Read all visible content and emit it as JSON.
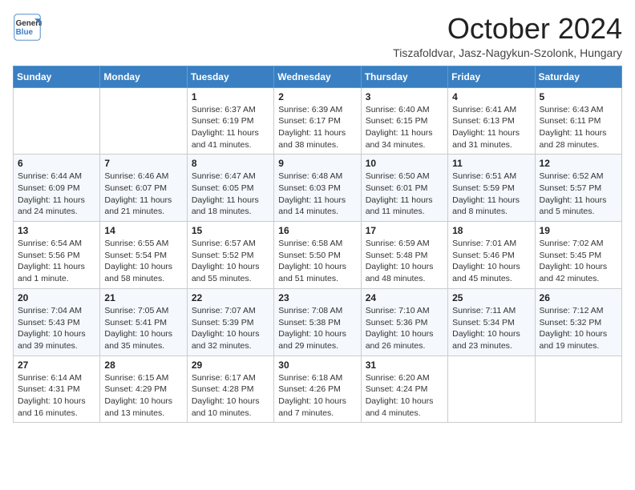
{
  "logo": {
    "line1": "General",
    "line2": "Blue"
  },
  "title": "October 2024",
  "subtitle": "Tiszafoldvar, Jasz-Nagykun-Szolonk, Hungary",
  "days_of_week": [
    "Sunday",
    "Monday",
    "Tuesday",
    "Wednesday",
    "Thursday",
    "Friday",
    "Saturday"
  ],
  "weeks": [
    [
      {
        "day": "",
        "info": ""
      },
      {
        "day": "",
        "info": ""
      },
      {
        "day": "1",
        "info": "Sunrise: 6:37 AM\nSunset: 6:19 PM\nDaylight: 11 hours and 41 minutes."
      },
      {
        "day": "2",
        "info": "Sunrise: 6:39 AM\nSunset: 6:17 PM\nDaylight: 11 hours and 38 minutes."
      },
      {
        "day": "3",
        "info": "Sunrise: 6:40 AM\nSunset: 6:15 PM\nDaylight: 11 hours and 34 minutes."
      },
      {
        "day": "4",
        "info": "Sunrise: 6:41 AM\nSunset: 6:13 PM\nDaylight: 11 hours and 31 minutes."
      },
      {
        "day": "5",
        "info": "Sunrise: 6:43 AM\nSunset: 6:11 PM\nDaylight: 11 hours and 28 minutes."
      }
    ],
    [
      {
        "day": "6",
        "info": "Sunrise: 6:44 AM\nSunset: 6:09 PM\nDaylight: 11 hours and 24 minutes."
      },
      {
        "day": "7",
        "info": "Sunrise: 6:46 AM\nSunset: 6:07 PM\nDaylight: 11 hours and 21 minutes."
      },
      {
        "day": "8",
        "info": "Sunrise: 6:47 AM\nSunset: 6:05 PM\nDaylight: 11 hours and 18 minutes."
      },
      {
        "day": "9",
        "info": "Sunrise: 6:48 AM\nSunset: 6:03 PM\nDaylight: 11 hours and 14 minutes."
      },
      {
        "day": "10",
        "info": "Sunrise: 6:50 AM\nSunset: 6:01 PM\nDaylight: 11 hours and 11 minutes."
      },
      {
        "day": "11",
        "info": "Sunrise: 6:51 AM\nSunset: 5:59 PM\nDaylight: 11 hours and 8 minutes."
      },
      {
        "day": "12",
        "info": "Sunrise: 6:52 AM\nSunset: 5:57 PM\nDaylight: 11 hours and 5 minutes."
      }
    ],
    [
      {
        "day": "13",
        "info": "Sunrise: 6:54 AM\nSunset: 5:56 PM\nDaylight: 11 hours and 1 minute."
      },
      {
        "day": "14",
        "info": "Sunrise: 6:55 AM\nSunset: 5:54 PM\nDaylight: 10 hours and 58 minutes."
      },
      {
        "day": "15",
        "info": "Sunrise: 6:57 AM\nSunset: 5:52 PM\nDaylight: 10 hours and 55 minutes."
      },
      {
        "day": "16",
        "info": "Sunrise: 6:58 AM\nSunset: 5:50 PM\nDaylight: 10 hours and 51 minutes."
      },
      {
        "day": "17",
        "info": "Sunrise: 6:59 AM\nSunset: 5:48 PM\nDaylight: 10 hours and 48 minutes."
      },
      {
        "day": "18",
        "info": "Sunrise: 7:01 AM\nSunset: 5:46 PM\nDaylight: 10 hours and 45 minutes."
      },
      {
        "day": "19",
        "info": "Sunrise: 7:02 AM\nSunset: 5:45 PM\nDaylight: 10 hours and 42 minutes."
      }
    ],
    [
      {
        "day": "20",
        "info": "Sunrise: 7:04 AM\nSunset: 5:43 PM\nDaylight: 10 hours and 39 minutes."
      },
      {
        "day": "21",
        "info": "Sunrise: 7:05 AM\nSunset: 5:41 PM\nDaylight: 10 hours and 35 minutes."
      },
      {
        "day": "22",
        "info": "Sunrise: 7:07 AM\nSunset: 5:39 PM\nDaylight: 10 hours and 32 minutes."
      },
      {
        "day": "23",
        "info": "Sunrise: 7:08 AM\nSunset: 5:38 PM\nDaylight: 10 hours and 29 minutes."
      },
      {
        "day": "24",
        "info": "Sunrise: 7:10 AM\nSunset: 5:36 PM\nDaylight: 10 hours and 26 minutes."
      },
      {
        "day": "25",
        "info": "Sunrise: 7:11 AM\nSunset: 5:34 PM\nDaylight: 10 hours and 23 minutes."
      },
      {
        "day": "26",
        "info": "Sunrise: 7:12 AM\nSunset: 5:32 PM\nDaylight: 10 hours and 19 minutes."
      }
    ],
    [
      {
        "day": "27",
        "info": "Sunrise: 6:14 AM\nSunset: 4:31 PM\nDaylight: 10 hours and 16 minutes."
      },
      {
        "day": "28",
        "info": "Sunrise: 6:15 AM\nSunset: 4:29 PM\nDaylight: 10 hours and 13 minutes."
      },
      {
        "day": "29",
        "info": "Sunrise: 6:17 AM\nSunset: 4:28 PM\nDaylight: 10 hours and 10 minutes."
      },
      {
        "day": "30",
        "info": "Sunrise: 6:18 AM\nSunset: 4:26 PM\nDaylight: 10 hours and 7 minutes."
      },
      {
        "day": "31",
        "info": "Sunrise: 6:20 AM\nSunset: 4:24 PM\nDaylight: 10 hours and 4 minutes."
      },
      {
        "day": "",
        "info": ""
      },
      {
        "day": "",
        "info": ""
      }
    ]
  ]
}
